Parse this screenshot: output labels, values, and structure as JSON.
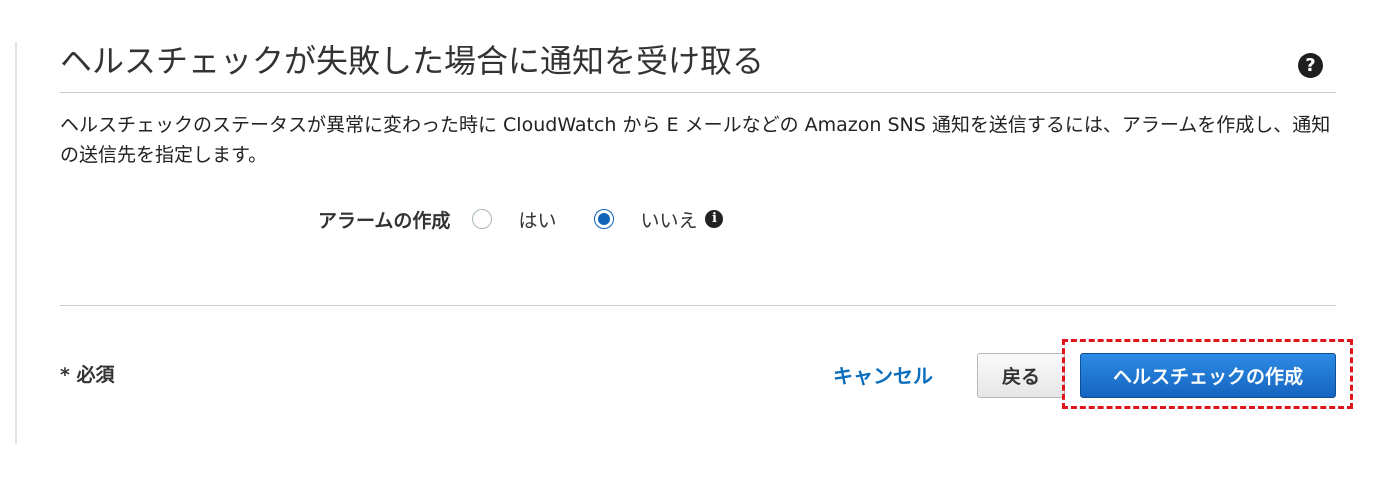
{
  "panel": {
    "title": "ヘルスチェックが失敗した場合に通知を受け取る",
    "help_icon": "question-circle-icon",
    "description": "ヘルスチェックのステータスが異常に変わった時に CloudWatch から E メールなどの Amazon SNS 通知を送信するには、アラームを作成し、通知の送信先を指定します。"
  },
  "alarm": {
    "label": "アラームの作成",
    "options": [
      {
        "label": "はい",
        "selected": false
      },
      {
        "label": "いいえ",
        "selected": true
      }
    ],
    "info_icon": "info-circle-icon"
  },
  "footer": {
    "required_note": "* 必須",
    "cancel_label": "キャンセル",
    "back_label": "戻る",
    "create_label": "ヘルスチェックの作成"
  },
  "colors": {
    "primary_button": "#1565c0",
    "link": "#0a6ebd",
    "radio_selected": "#0f63b8",
    "highlight_dashed": "#e0141b"
  }
}
